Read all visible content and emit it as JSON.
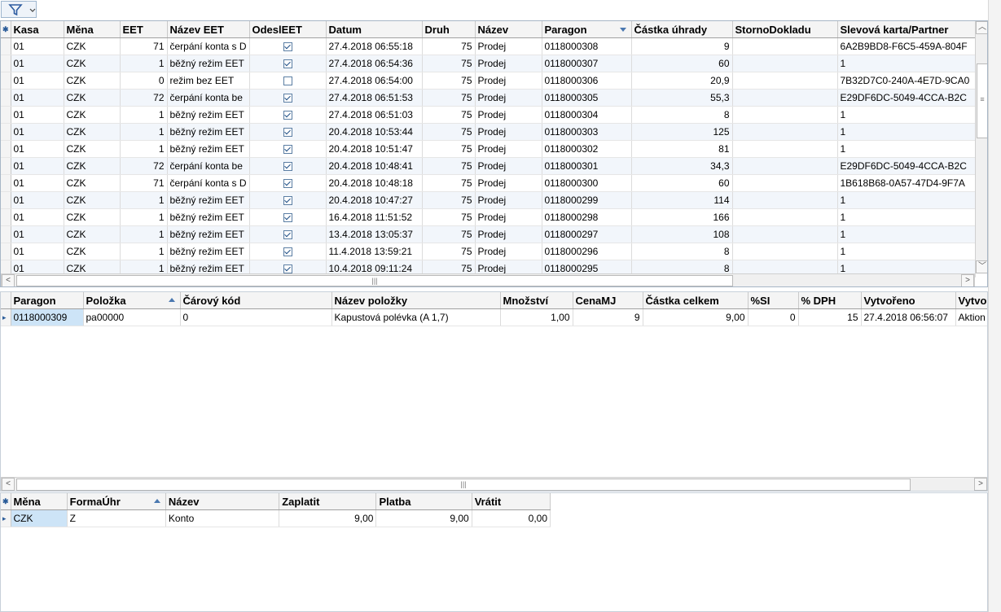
{
  "toolbar": {
    "filter_icon": "filter-icon",
    "dropdown_icon": "chevron-down-icon"
  },
  "receipts": {
    "columns": [
      "Kasa",
      "Měna",
      "EET",
      "Název EET",
      "OdeslEET",
      "Datum",
      "Druh",
      "Název",
      "Paragon",
      "Částka úhrady",
      "StornoDokladu",
      "Slevová karta/Partner"
    ],
    "rows": [
      [
        "01",
        "CZK",
        "71",
        "čerpání konta s D",
        true,
        "27.4.2018 06:55:18",
        "75",
        "Prodej",
        "0118000308",
        "9",
        "",
        "6A2B9BD8-F6C5-459A-804F"
      ],
      [
        "01",
        "CZK",
        "1",
        "běžný režim EET",
        true,
        "27.4.2018 06:54:36",
        "75",
        "Prodej",
        "0118000307",
        "60",
        "",
        "1"
      ],
      [
        "01",
        "CZK",
        "0",
        "režim bez EET",
        false,
        "27.4.2018 06:54:00",
        "75",
        "Prodej",
        "0118000306",
        "20,9",
        "",
        "7B32D7C0-240A-4E7D-9CA0"
      ],
      [
        "01",
        "CZK",
        "72",
        "čerpání konta be",
        true,
        "27.4.2018 06:51:53",
        "75",
        "Prodej",
        "0118000305",
        "55,3",
        "",
        "E29DF6DC-5049-4CCA-B2C"
      ],
      [
        "01",
        "CZK",
        "1",
        "běžný režim EET",
        true,
        "27.4.2018 06:51:03",
        "75",
        "Prodej",
        "0118000304",
        "8",
        "",
        "1"
      ],
      [
        "01",
        "CZK",
        "1",
        "běžný režim EET",
        true,
        "20.4.2018 10:53:44",
        "75",
        "Prodej",
        "0118000303",
        "125",
        "",
        "1"
      ],
      [
        "01",
        "CZK",
        "1",
        "běžný režim EET",
        true,
        "20.4.2018 10:51:47",
        "75",
        "Prodej",
        "0118000302",
        "81",
        "",
        "1"
      ],
      [
        "01",
        "CZK",
        "72",
        "čerpání konta be",
        true,
        "20.4.2018 10:48:41",
        "75",
        "Prodej",
        "0118000301",
        "34,3",
        "",
        "E29DF6DC-5049-4CCA-B2C"
      ],
      [
        "01",
        "CZK",
        "71",
        "čerpání konta s D",
        true,
        "20.4.2018 10:48:18",
        "75",
        "Prodej",
        "0118000300",
        "60",
        "",
        "1B618B68-0A57-47D4-9F7A"
      ],
      [
        "01",
        "CZK",
        "1",
        "běžný režim EET",
        true,
        "20.4.2018 10:47:27",
        "75",
        "Prodej",
        "0118000299",
        "114",
        "",
        "1"
      ],
      [
        "01",
        "CZK",
        "1",
        "běžný režim EET",
        true,
        "16.4.2018 11:51:52",
        "75",
        "Prodej",
        "0118000298",
        "166",
        "",
        "1"
      ],
      [
        "01",
        "CZK",
        "1",
        "běžný režim EET",
        true,
        "13.4.2018 13:05:37",
        "75",
        "Prodej",
        "0118000297",
        "108",
        "",
        "1"
      ],
      [
        "01",
        "CZK",
        "1",
        "běžný režim EET",
        true,
        "11.4.2018 13:59:21",
        "75",
        "Prodej",
        "0118000296",
        "8",
        "",
        "1"
      ],
      [
        "01",
        "CZK",
        "1",
        "běžný režim EET",
        true,
        "10.4.2018 09:11:24",
        "75",
        "Prodej",
        "0118000295",
        "8",
        "",
        "1"
      ]
    ]
  },
  "items": {
    "columns": [
      "Paragon",
      "Položka",
      "Čárový kód",
      "Název položky",
      "Množství",
      "CenaMJ",
      "Částka celkem",
      "%SI",
      "% DPH",
      "Vytvořeno",
      "Vytvoi"
    ],
    "rows": [
      [
        "0118000309",
        "pa00000",
        "0",
        "Kapustová polévka (A 1,7)",
        "1,00",
        "9",
        "9,00",
        "0",
        "15",
        "27.4.2018 06:56:07",
        "Aktion"
      ]
    ]
  },
  "payments": {
    "columns": [
      "Měna",
      "FormaÚhr",
      "Název",
      "Zaplatit",
      "Platba",
      "Vrátit"
    ],
    "rows": [
      [
        "CZK",
        "Z",
        "Konto",
        "9,00",
        "9,00",
        "0,00"
      ]
    ]
  }
}
